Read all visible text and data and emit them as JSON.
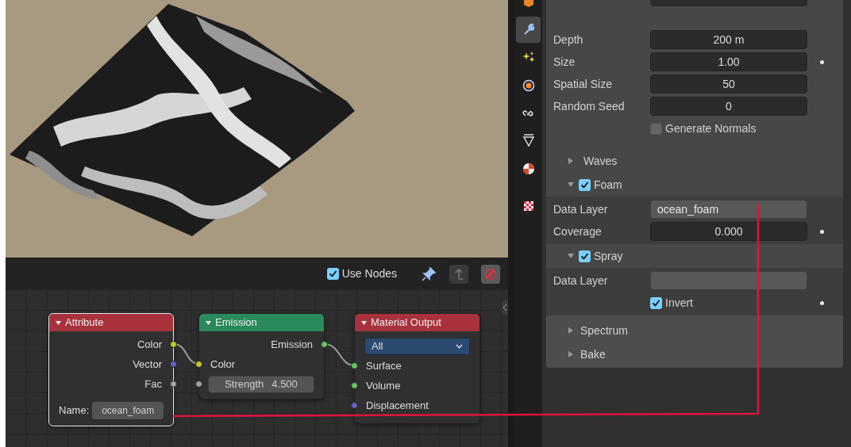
{
  "node_editor": {
    "use_nodes": {
      "label": "Use Nodes",
      "checked": true
    },
    "nodes": [
      {
        "title": "Attribute",
        "color": "#a8323c",
        "selected": true,
        "sockets": [
          {
            "kind": "output",
            "label": "Color",
            "color": "#c7c729"
          },
          {
            "kind": "output",
            "label": "Vector",
            "color": "#6363c7"
          },
          {
            "kind": "output",
            "label": "Fac",
            "color": "#a1a1a1"
          }
        ],
        "name_field": {
          "label": "Name:",
          "value": "ocean_foam"
        }
      },
      {
        "title": "Emission",
        "color": "#2a8a5c",
        "selected": false,
        "sockets": [
          {
            "kind": "output",
            "label": "Emission",
            "color": "#63c763"
          },
          {
            "kind": "input",
            "label": "Color",
            "color": "#c7c729"
          },
          {
            "kind": "value",
            "label": "Strength",
            "value": "4.500",
            "color": "#a1a1a1"
          }
        ]
      },
      {
        "title": "Material Output",
        "color": "#a8323c",
        "selected": false,
        "dropdown": "All",
        "sockets": [
          {
            "kind": "input",
            "label": "Surface",
            "color": "#63c763"
          },
          {
            "kind": "input",
            "label": "Volume",
            "color": "#63c763"
          },
          {
            "kind": "input",
            "label": "Displacement",
            "color": "#6363c7"
          }
        ]
      }
    ]
  },
  "properties": {
    "tabs": [
      {
        "selected": false
      },
      {
        "selected": true
      },
      {
        "selected": false
      },
      {
        "selected": false
      },
      {
        "selected": false
      },
      {
        "selected": false
      },
      {
        "selected": false
      },
      {
        "selected": false
      }
    ],
    "rows": [
      {
        "kind": "number",
        "label": "Depth",
        "value": "200 m",
        "keyframe": false
      },
      {
        "kind": "number",
        "label": "Size",
        "value": "1.00",
        "keyframe": true
      },
      {
        "kind": "number",
        "label": "Spatial Size",
        "value": "50",
        "keyframe": false
      },
      {
        "kind": "number",
        "label": "Random Seed",
        "value": "0",
        "keyframe": false
      },
      {
        "kind": "checkbox",
        "label": "Generate Normals",
        "checked": false,
        "keyframe": false
      },
      {
        "kind": "subpanel",
        "label": "Waves",
        "expanded": false
      },
      {
        "kind": "subpanel",
        "label": "Foam",
        "expanded": true,
        "checked": true,
        "children": [
          {
            "kind": "text",
            "label": "Data Layer",
            "value": "ocean_foam"
          },
          {
            "kind": "number",
            "label": "Coverage",
            "value": "0.000",
            "keyframe": true
          }
        ]
      },
      {
        "kind": "subpanel",
        "label": "Spray",
        "expanded": true,
        "checked": true,
        "children": [
          {
            "kind": "text",
            "label": "Data Layer"
          },
          {
            "kind": "checkbox",
            "label": "Invert",
            "checked": true,
            "keyframe": true
          }
        ]
      }
    ],
    "closed_panels": [
      {
        "label": "Spectrum",
        "expanded": false
      },
      {
        "label": "Bake",
        "expanded": false
      }
    ]
  }
}
